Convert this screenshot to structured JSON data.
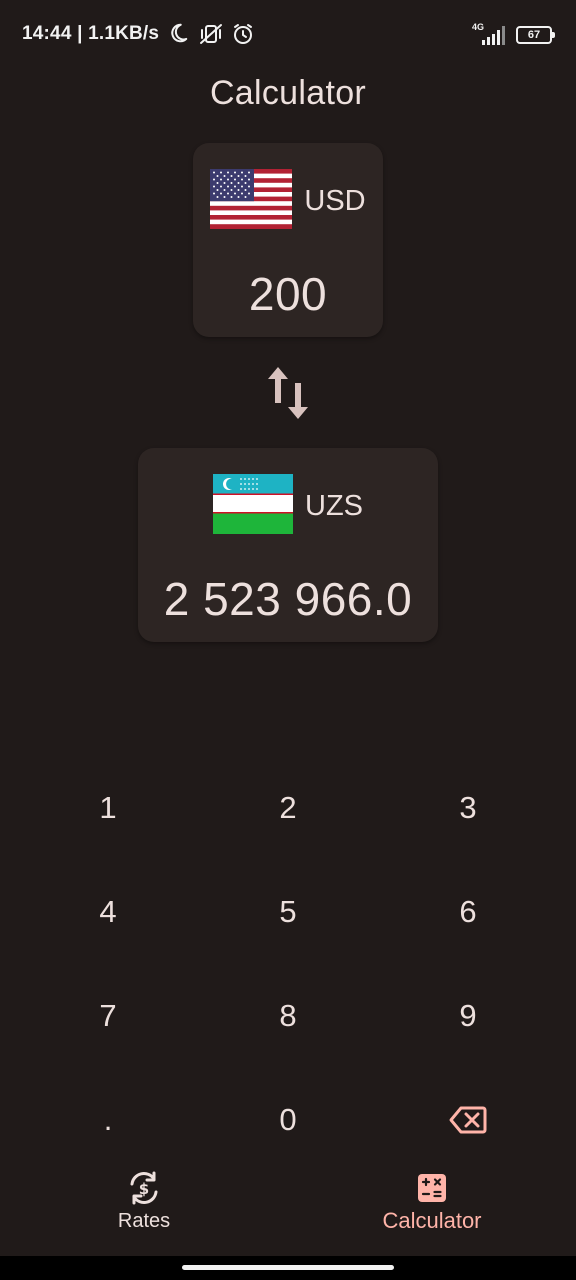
{
  "status_bar": {
    "time_speed": "14:44 | 1.1KB/s",
    "network": "4G",
    "battery": "67"
  },
  "header": {
    "title": "Calculator"
  },
  "from_currency": {
    "code": "USD",
    "amount": "200",
    "flag": "us-flag-icon"
  },
  "to_currency": {
    "code": "UZS",
    "amount": "2 523 966.0",
    "flag": "uz-flag-icon"
  },
  "keypad": {
    "keys": [
      "1",
      "2",
      "3",
      "4",
      "5",
      "6",
      "7",
      "8",
      "9",
      ".",
      "0"
    ],
    "backspace_icon": "backspace-icon"
  },
  "bottom_nav": {
    "items": [
      {
        "label": "Rates",
        "icon": "currency-exchange-icon",
        "active": false
      },
      {
        "label": "Calculator",
        "icon": "calculator-icon",
        "active": true
      }
    ]
  },
  "colors": {
    "background": "#201a19",
    "card": "#2d2523",
    "text": "#ede0dd",
    "accent": "#ffb4a9",
    "swap_arrows": "#d8c2be"
  }
}
